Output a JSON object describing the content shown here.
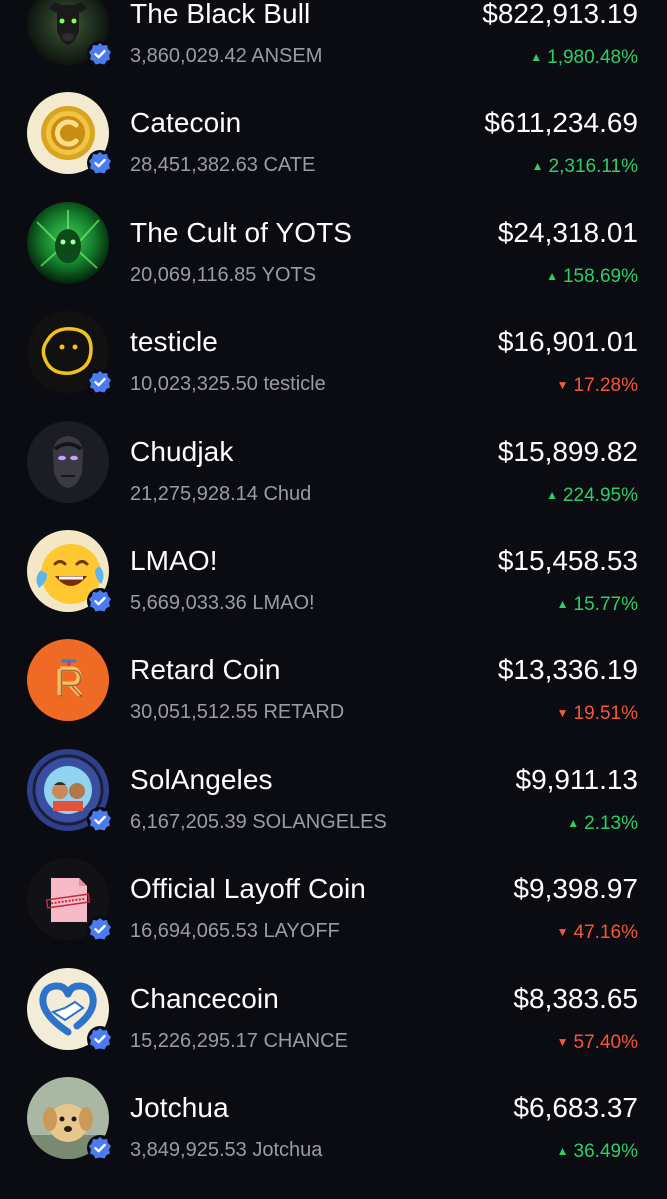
{
  "colors": {
    "background": "#0b0b12",
    "up": "#2fce66",
    "down": "#f5573a",
    "muted": "#9b9ba6",
    "verified": "#4a7cf0"
  },
  "tokens": [
    {
      "name": "The Black Bull",
      "holding": "3,860,029.42 ANSEM",
      "value": "$822,913.19",
      "change": "1,980.48%",
      "direction": "up",
      "arrow": "▲",
      "icon": "black-bull-icon",
      "verified": true
    },
    {
      "name": "Catecoin",
      "holding": "28,451,382.63 CATE",
      "value": "$611,234.69",
      "change": "2,316.11%",
      "direction": "up",
      "arrow": "▲",
      "icon": "catecoin-icon",
      "verified": true
    },
    {
      "name": "The Cult of YOTS",
      "holding": "20,069,116.85 YOTS",
      "value": "$24,318.01",
      "change": "158.69%",
      "direction": "up",
      "arrow": "▲",
      "icon": "yots-icon",
      "verified": false
    },
    {
      "name": "testicle",
      "holding": "10,023,325.50 testicle",
      "value": "$16,901.01",
      "change": "17.28%",
      "direction": "down",
      "arrow": "▼",
      "icon": "testicle-face-icon",
      "verified": true
    },
    {
      "name": "Chudjak",
      "holding": "21,275,928.14 Chud",
      "value": "$15,899.82",
      "change": "224.95%",
      "direction": "up",
      "arrow": "▲",
      "icon": "chudjak-icon",
      "verified": false
    },
    {
      "name": "LMAO!",
      "holding": "5,669,033.36 LMAO!",
      "value": "$15,458.53",
      "change": "15.77%",
      "direction": "up",
      "arrow": "▲",
      "icon": "laughing-emoji-icon",
      "verified": true
    },
    {
      "name": "Retard Coin",
      "holding": "30,051,512.55 RETARD",
      "value": "$13,336.19",
      "change": "19.51%",
      "direction": "down",
      "arrow": "▼",
      "icon": "retard-coin-icon",
      "verified": false
    },
    {
      "name": "SolAngeles",
      "holding": "6,167,205.39 SOLANGELES",
      "value": "$9,911.13",
      "change": "2.13%",
      "direction": "up",
      "arrow": "▲",
      "icon": "solangeles-badge-icon",
      "verified": true
    },
    {
      "name": "Official Layoff Coin",
      "holding": "16,694,065.53 LAYOFF",
      "value": "$9,398.97",
      "change": "47.16%",
      "direction": "down",
      "arrow": "▼",
      "icon": "terminated-paper-icon",
      "verified": true
    },
    {
      "name": "Chancecoin",
      "holding": "15,226,295.17 CHANCE",
      "value": "$8,383.65",
      "change": "57.40%",
      "direction": "down",
      "arrow": "▼",
      "icon": "handshake-heart-icon",
      "verified": true
    },
    {
      "name": "Jotchua",
      "holding": "3,849,925.53 Jotchua",
      "value": "$6,683.37",
      "change": "36.49%",
      "direction": "up",
      "arrow": "▲",
      "icon": "puppy-icon",
      "verified": true
    }
  ]
}
